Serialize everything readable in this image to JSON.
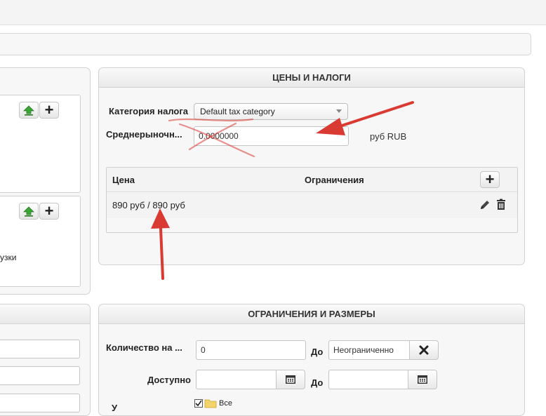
{
  "prices_panel": {
    "title": "ЦЕНЫ И НАЛОГИ",
    "tax_category_label": "Категория налога",
    "tax_category_value": "Default tax category",
    "market_price_label": "Среднерыночн...",
    "market_price_value": "0.0000000",
    "currency_label": "руб RUB",
    "table": {
      "col_price": "Цена",
      "col_limits": "Ограничения",
      "rows": [
        {
          "price": "890 руб / 890 руб"
        }
      ]
    }
  },
  "limits_panel": {
    "title": "ОГРАНИЧЕНИЯ И РАЗМЕРЫ",
    "quantity_label": "Количество на ...",
    "quantity_value": "0",
    "to_label": "До",
    "quantity_to_value": "Неограниченно",
    "available_label": "Доступно",
    "available_to_label": "До",
    "tree_partial_label": "У",
    "tree_all_label": "Все"
  },
  "left_panel": {
    "partial_text": "узки"
  },
  "icons": {
    "upload": "upload-icon",
    "add": "plus-icon",
    "edit": "pencil-icon",
    "delete": "trash-icon",
    "calendar": "calendar-icon",
    "clear": "x-icon",
    "folder": "folder-icon"
  },
  "colors": {
    "annotation_red": "#d93a32",
    "upload_green": "#3aa635"
  }
}
